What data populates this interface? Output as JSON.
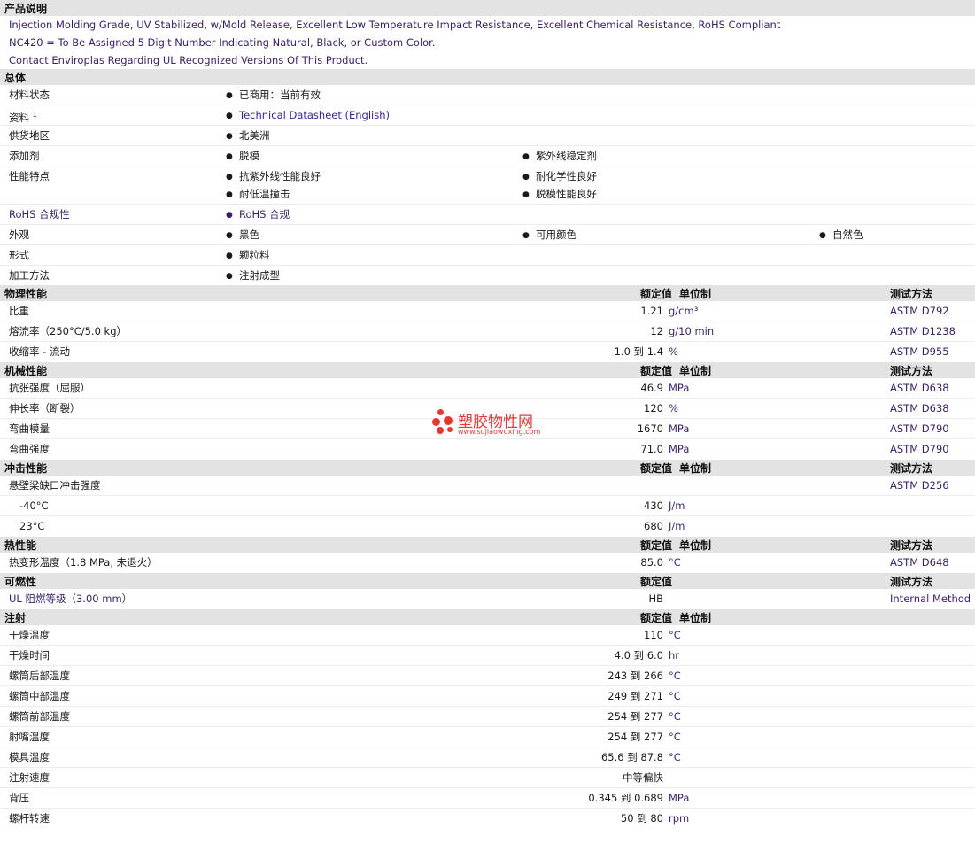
{
  "sections": {
    "desc": "产品说明",
    "general": "总体",
    "physical": "物理性能",
    "mechanical": "机械性能",
    "impact": "冲击性能",
    "thermal": "热性能",
    "flammability": "可燃性",
    "injection": "注射"
  },
  "col_headers": {
    "value": "额定值",
    "unit": "单位制",
    "method": "测试方法"
  },
  "description": [
    "Injection Molding Grade, UV Stabilized, w/Mold Release, Excellent Low Temperature Impact Resistance, Excellent Chemical Resistance, RoHS Compliant",
    "NC420 = To Be Assigned 5 Digit Number Indicating Natural, Black, or Custom Color.",
    "Contact Enviroplas Regarding UL Recognized Versions Of This Product."
  ],
  "general": {
    "status_label": "材料状态",
    "status": "已商用：当前有效",
    "docs_label": "资料",
    "docs_sup": "1",
    "docs_link": "Technical Datasheet (English)",
    "region_label": "供货地区",
    "region": "北美洲",
    "additive_label": "添加剂",
    "additive_1": "脱模",
    "additive_2": "紫外线稳定剂",
    "features_label": "性能特点",
    "feature_1": "抗紫外线性能良好",
    "feature_2": "耐化学性良好",
    "feature_3": "耐低温撞击",
    "feature_4": "脱模性能良好",
    "rohs_label": "RoHS 合规性",
    "rohs": "RoHS 合规",
    "appearance_label": "外观",
    "appearance_1": "黑色",
    "appearance_2": "可用颜色",
    "appearance_3": "自然色",
    "form_label": "形式",
    "form": "颗粒料",
    "process_label": "加工方法",
    "process": "注射成型"
  },
  "physical": [
    {
      "name": "比重",
      "value": "1.21",
      "unit": "g/cm³",
      "method": "ASTM D792"
    },
    {
      "name": "熔流率（250°C/5.0 kg）",
      "value": "12",
      "unit": "g/10 min",
      "method": "ASTM D1238"
    },
    {
      "name": "收缩率 - 流动",
      "value": "1.0 到  1.4",
      "unit": "%",
      "method": "ASTM D955"
    }
  ],
  "mechanical": [
    {
      "name": "抗张强度（屈服）",
      "value": "46.9",
      "unit": "MPa",
      "method": "ASTM D638"
    },
    {
      "name": "伸长率（断裂）",
      "value": "120",
      "unit": "%",
      "method": "ASTM D638"
    },
    {
      "name": "弯曲模量",
      "value": "1670",
      "unit": "MPa",
      "method": "ASTM D790"
    },
    {
      "name": "弯曲强度",
      "value": "71.0",
      "unit": "MPa",
      "method": "ASTM D790"
    }
  ],
  "impact": {
    "name": "悬壁梁缺口冲击强度",
    "method": "ASTM D256",
    "rows": [
      {
        "name": "-40°C",
        "value": "430",
        "unit": "J/m"
      },
      {
        "name": "23°C",
        "value": "680",
        "unit": "J/m"
      }
    ]
  },
  "thermal": [
    {
      "name": "热变形温度（1.8 MPa, 未退火）",
      "value": "85.0",
      "unit": "°C",
      "method": "ASTM D648"
    }
  ],
  "flammability": [
    {
      "name": "UL 阻燃等级（3.00 mm）",
      "value": "HB",
      "unit": "",
      "method": "Internal Method"
    }
  ],
  "injection": [
    {
      "name": "干燥温度",
      "value": "110",
      "unit": "°C"
    },
    {
      "name": "干燥时间",
      "value": "4.0 到  6.0",
      "unit": "hr"
    },
    {
      "name": "螺筒后部温度",
      "value": "243 到  266",
      "unit": "°C"
    },
    {
      "name": "螺筒中部温度",
      "value": "249 到  271",
      "unit": "°C"
    },
    {
      "name": "螺筒前部温度",
      "value": "254 到  277",
      "unit": "°C"
    },
    {
      "name": "射嘴温度",
      "value": "254 到  277",
      "unit": "°C"
    },
    {
      "name": "模具温度",
      "value": "65.6 到  87.8",
      "unit": "°C"
    },
    {
      "name": "注射速度",
      "value": "中等偏快",
      "unit": ""
    },
    {
      "name": "背压",
      "value": "0.345 到  0.689",
      "unit": "MPa"
    },
    {
      "name": "螺杆转速",
      "value": "50 到  80",
      "unit": "rpm"
    }
  ],
  "watermark": {
    "text": "塑胶物性网",
    "url": "www.sujiaowuxing.com"
  }
}
